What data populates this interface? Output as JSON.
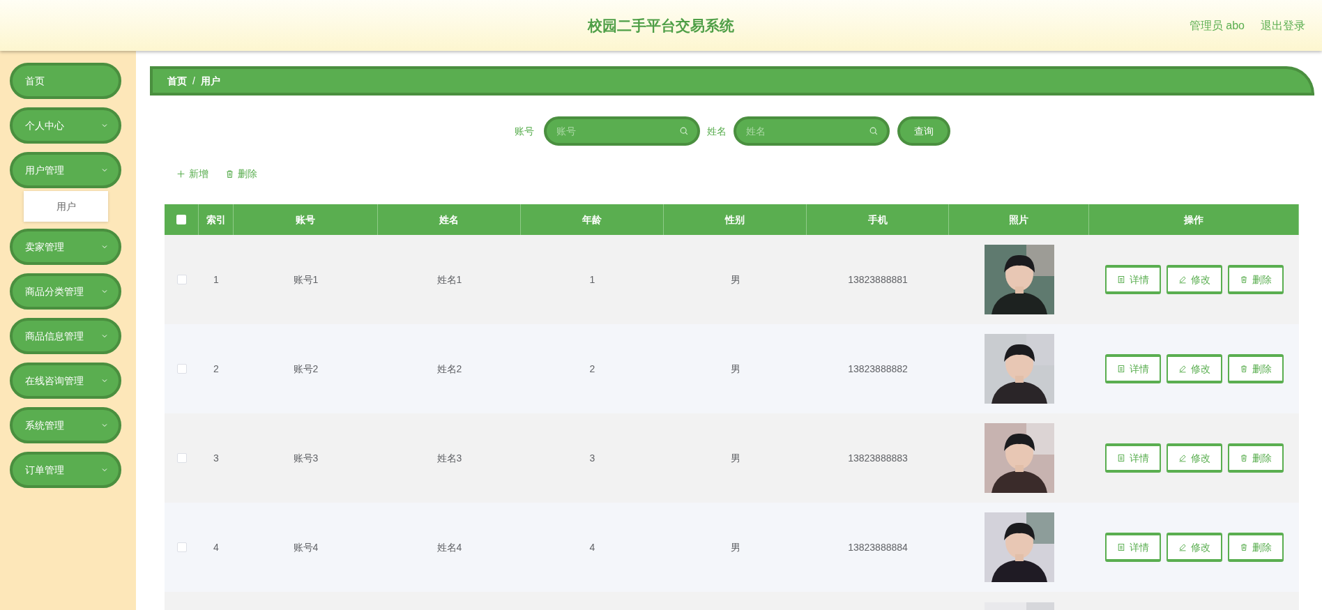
{
  "header": {
    "title": "校园二手平台交易系统",
    "user": "管理员 abo",
    "logout": "退出登录"
  },
  "sidebar": {
    "items": [
      {
        "label": "首页",
        "kind": "link"
      },
      {
        "label": "个人中心",
        "kind": "menu"
      },
      {
        "label": "用户管理",
        "kind": "menu",
        "children": [
          {
            "label": "用户"
          }
        ]
      },
      {
        "label": "卖家管理",
        "kind": "menu"
      },
      {
        "label": "商品分类管理",
        "kind": "menu"
      },
      {
        "label": "商品信息管理",
        "kind": "menu"
      },
      {
        "label": "在线咨询管理",
        "kind": "menu"
      },
      {
        "label": "系统管理",
        "kind": "menu"
      },
      {
        "label": "订单管理",
        "kind": "menu"
      }
    ]
  },
  "breadcrumb": {
    "items": [
      "首页",
      "用户"
    ],
    "separator": "/"
  },
  "search": {
    "fields": [
      {
        "label": "账号",
        "placeholder": "账号"
      },
      {
        "label": "姓名",
        "placeholder": "姓名"
      }
    ],
    "button": "查询"
  },
  "toolbar": [
    {
      "kind": "add",
      "label": "新增"
    },
    {
      "kind": "delete",
      "label": "删除"
    }
  ],
  "table": {
    "select_all": {
      "checked": false
    },
    "columns": [
      "索引",
      "账号",
      "姓名",
      "年龄",
      "性别",
      "手机",
      "照片",
      "操作"
    ],
    "rows": [
      {
        "checked": false,
        "cells": [
          "1",
          "账号1",
          "姓名1",
          "1",
          "男",
          "13823888881"
        ],
        "photo": {
          "kind": "picture"
        },
        "actions": [
          {
            "kind": "detail",
            "label": "详情"
          },
          {
            "kind": "edit",
            "label": "修改"
          },
          {
            "kind": "delete",
            "label": "删除"
          }
        ]
      },
      {
        "checked": false,
        "cells": [
          "2",
          "账号2",
          "姓名2",
          "2",
          "男",
          "13823888882"
        ],
        "photo": {
          "kind": "picture"
        },
        "actions": [
          {
            "kind": "detail",
            "label": "详情"
          },
          {
            "kind": "edit",
            "label": "修改"
          },
          {
            "kind": "delete",
            "label": "删除"
          }
        ]
      },
      {
        "checked": false,
        "cells": [
          "3",
          "账号3",
          "姓名3",
          "3",
          "男",
          "13823888883"
        ],
        "photo": {
          "kind": "picture"
        },
        "actions": [
          {
            "kind": "detail",
            "label": "详情"
          },
          {
            "kind": "edit",
            "label": "修改"
          },
          {
            "kind": "delete",
            "label": "删除"
          }
        ]
      },
      {
        "checked": false,
        "cells": [
          "4",
          "账号4",
          "姓名4",
          "4",
          "男",
          "13823888884"
        ],
        "photo": {
          "kind": "picture"
        },
        "actions": [
          {
            "kind": "detail",
            "label": "详情"
          },
          {
            "kind": "edit",
            "label": "修改"
          },
          {
            "kind": "delete",
            "label": "删除"
          }
        ]
      },
      {
        "photo": {
          "kind": "picture"
        }
      }
    ]
  }
}
